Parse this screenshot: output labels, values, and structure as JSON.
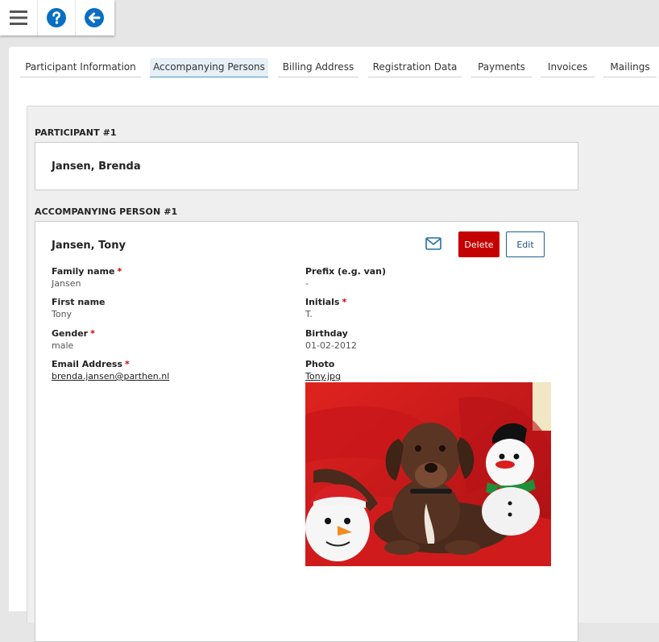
{
  "toolbar": {
    "icons": [
      "menu-icon",
      "help-icon",
      "back-arrow-icon"
    ]
  },
  "tabs": [
    {
      "label": "Participant Information",
      "active": false
    },
    {
      "label": "Accompanying Persons",
      "active": true
    },
    {
      "label": "Billing Address",
      "active": false
    },
    {
      "label": "Registration Data",
      "active": false
    },
    {
      "label": "Payments",
      "active": false
    },
    {
      "label": "Invoices",
      "active": false
    },
    {
      "label": "Mailings",
      "active": false
    }
  ],
  "participant": {
    "section_title": "PARTICIPANT #1",
    "name": "Jansen, Brenda"
  },
  "accompanying": {
    "section_title": "ACCOMPANYING PERSON #1",
    "name": "Jansen, Tony",
    "delete_label": "Delete",
    "edit_label": "Edit",
    "fields": {
      "family_name": {
        "label": "Family name",
        "value": "Jansen",
        "required": true
      },
      "prefix": {
        "label": "Prefix (e.g. van)",
        "value": "-",
        "required": false
      },
      "first_name": {
        "label": "First name",
        "value": "Tony",
        "required": false
      },
      "initials": {
        "label": "Initials",
        "value": "T.",
        "required": true
      },
      "gender": {
        "label": "Gender",
        "value": "male",
        "required": true
      },
      "birthday": {
        "label": "Birthday",
        "value": "01-02-2012",
        "required": false
      },
      "email": {
        "label": "Email Address",
        "value": "brenda.jansen@parthen.nl",
        "required": true
      },
      "photo": {
        "label": "Photo",
        "value": "Tony.jpg",
        "required": false
      }
    },
    "required_mark": "*"
  },
  "colors": {
    "accent": "#0a6fc2",
    "delete": "#c40000",
    "edit_border": "#1f5f93",
    "required": "#cc0000"
  }
}
